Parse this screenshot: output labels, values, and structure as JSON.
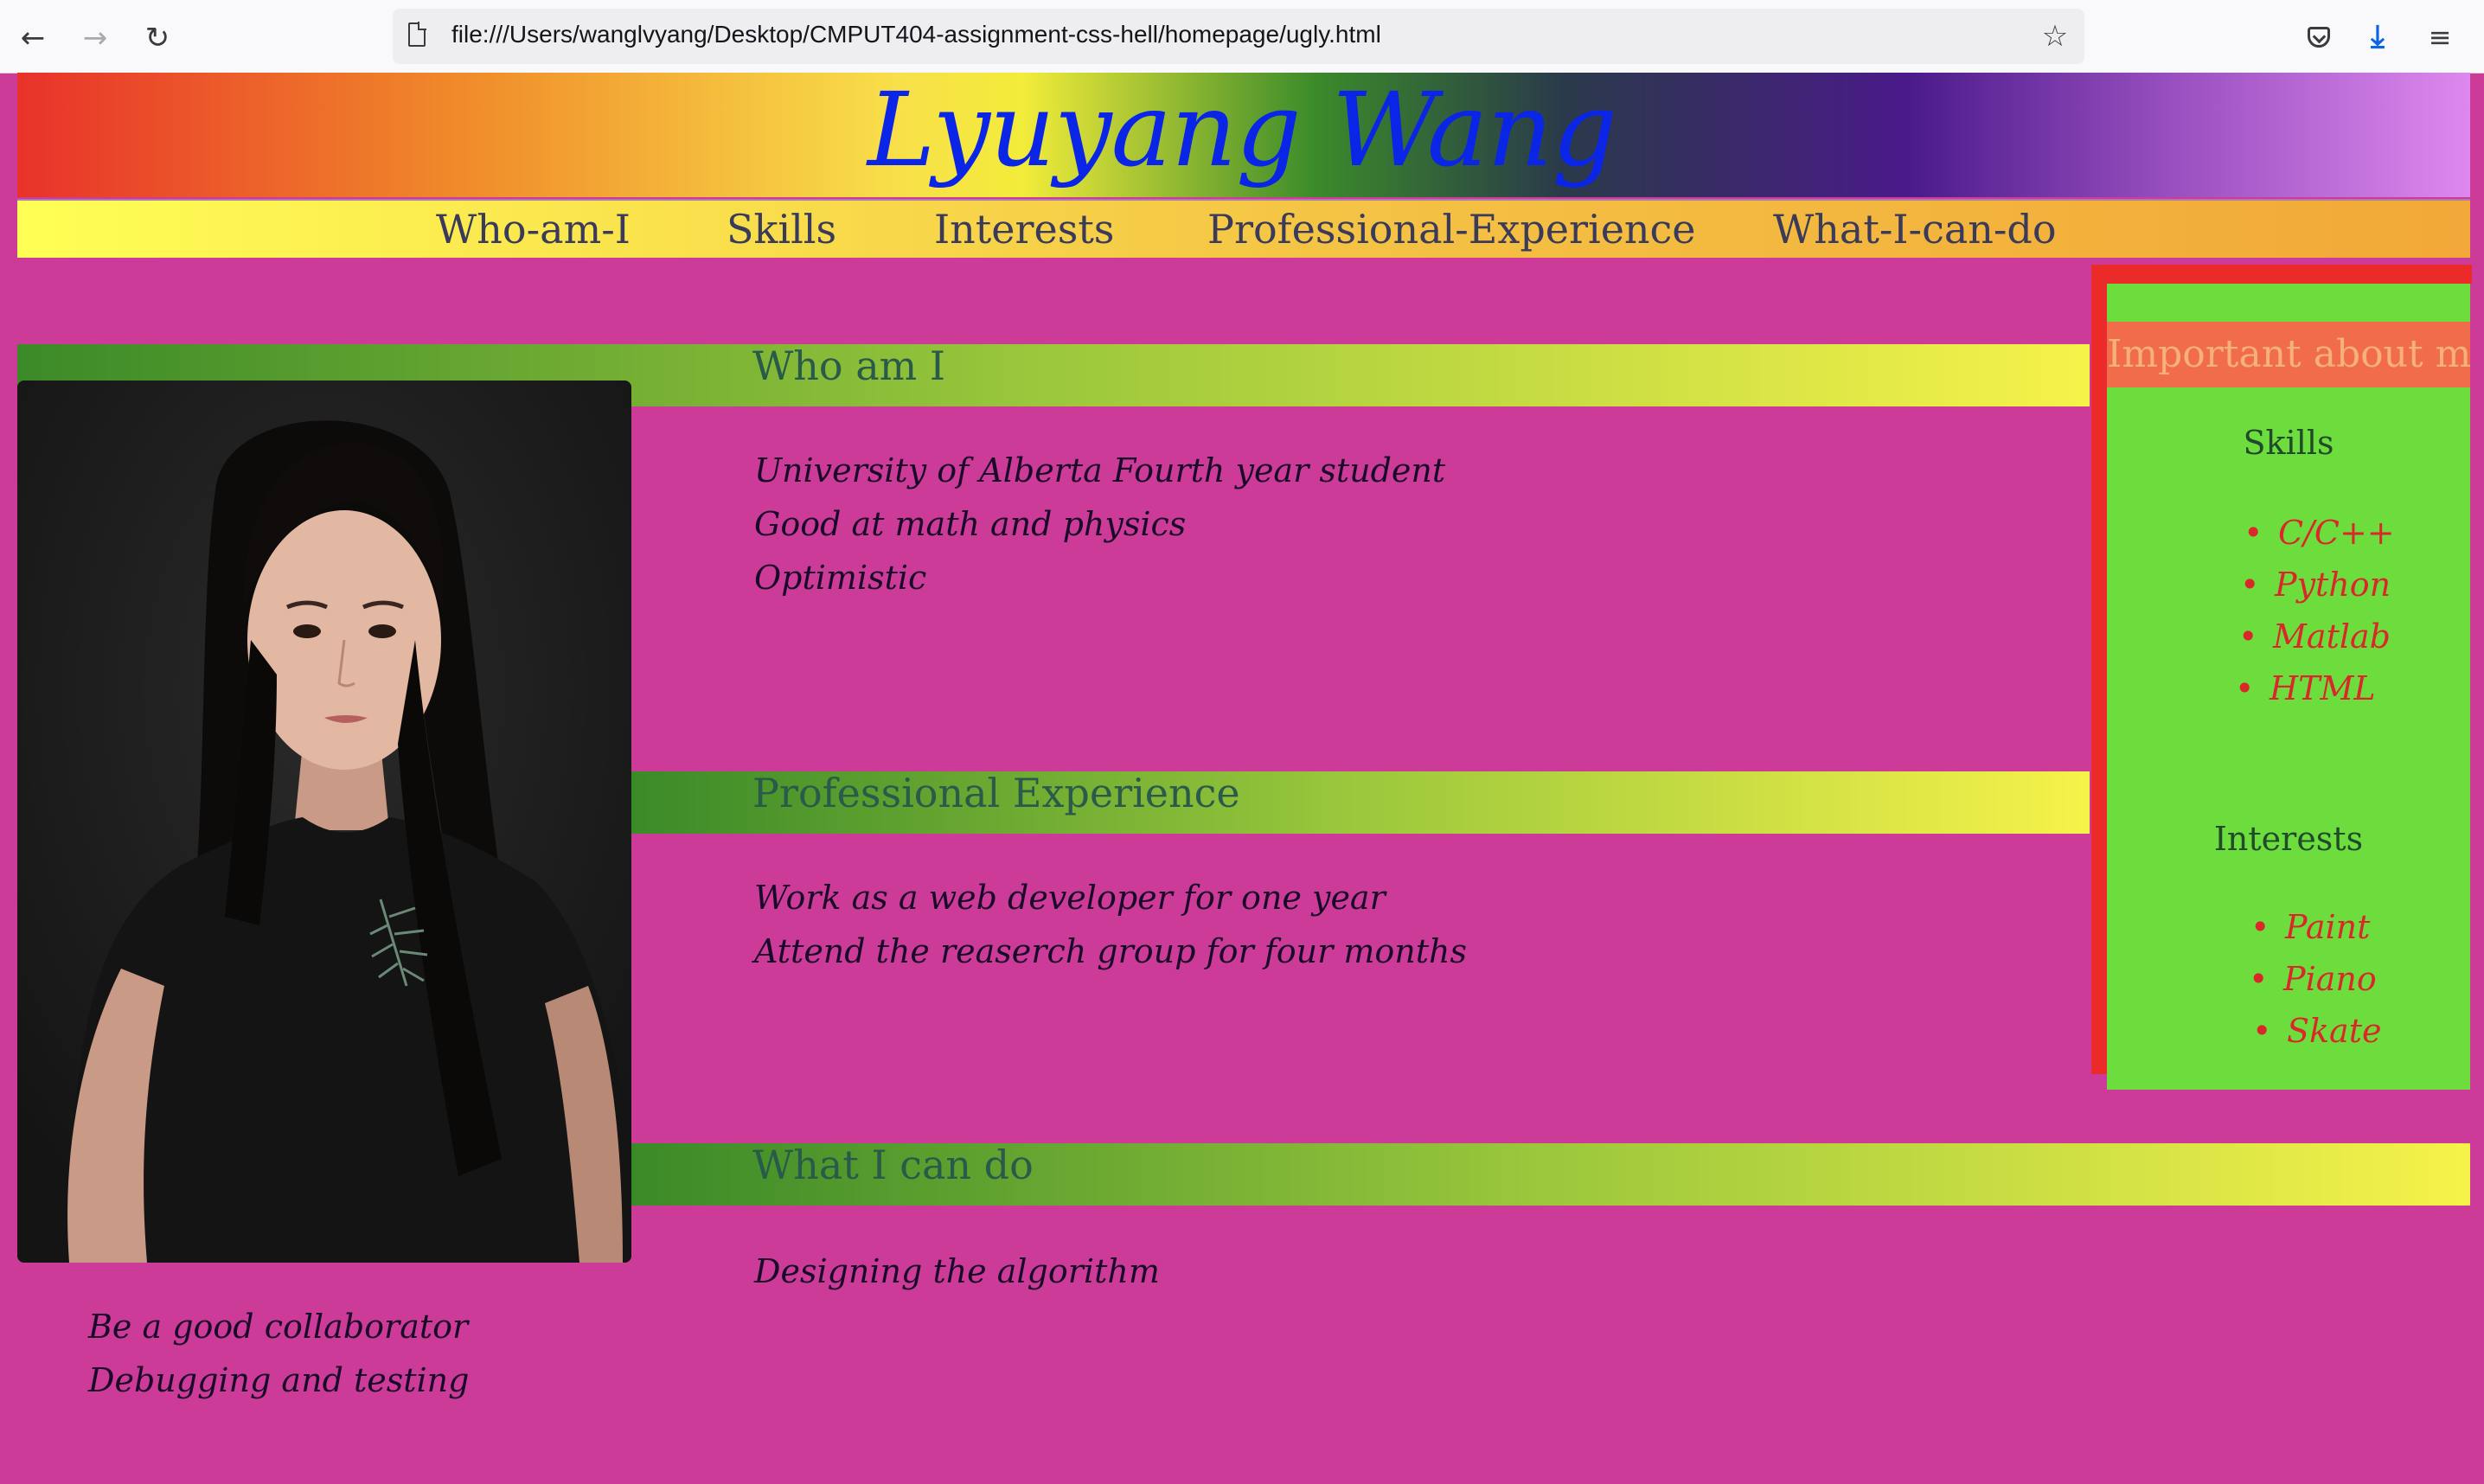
{
  "browser": {
    "back_icon": "arrow-left-icon",
    "forward_icon": "arrow-right-icon",
    "reload_icon": "reload-icon",
    "url": "file:///Users/wanglvyang/Desktop/CMPUT404-assignment-css-hell/homepage/ugly.html",
    "bookmark_icon": "star-icon",
    "pocket_icon": "pocket-icon",
    "download_icon": "download-icon",
    "menu_icon": "hamburger-menu-icon"
  },
  "header": {
    "title": "Lyuyang Wang"
  },
  "nav": {
    "items": [
      {
        "label": "Who-am-I"
      },
      {
        "label": "Skills"
      },
      {
        "label": "Interests"
      },
      {
        "label": "Professional-Experience"
      },
      {
        "label": "What-I-can-do"
      }
    ]
  },
  "sections": {
    "who": {
      "title": "Who am I",
      "lines": [
        "University of Alberta Fourth year student",
        "Good at math and physics",
        "Optimistic"
      ]
    },
    "professional": {
      "title": "Professional Experience",
      "lines": [
        "Work as a web developer for one year",
        "Attend the reaserch group for four months"
      ]
    },
    "can_do": {
      "title": "What I can do",
      "lines": [
        "Designing the algorithm",
        "Be a good collaborator",
        "Debugging and testing"
      ]
    }
  },
  "aside": {
    "title": "Important about me",
    "skills_heading": "Skills",
    "skills": [
      "C/C++",
      "Python",
      "Matlab",
      "HTML"
    ],
    "interests_heading": "Interests",
    "interests": [
      "Paint",
      "Piano",
      "Skate"
    ]
  },
  "colors": {
    "page_bg": "#cc3b98",
    "title_blue": "#0a25e6",
    "aside_green": "#6ddd3e",
    "aside_red": "#ea2b2a",
    "list_red": "#d8282a"
  }
}
